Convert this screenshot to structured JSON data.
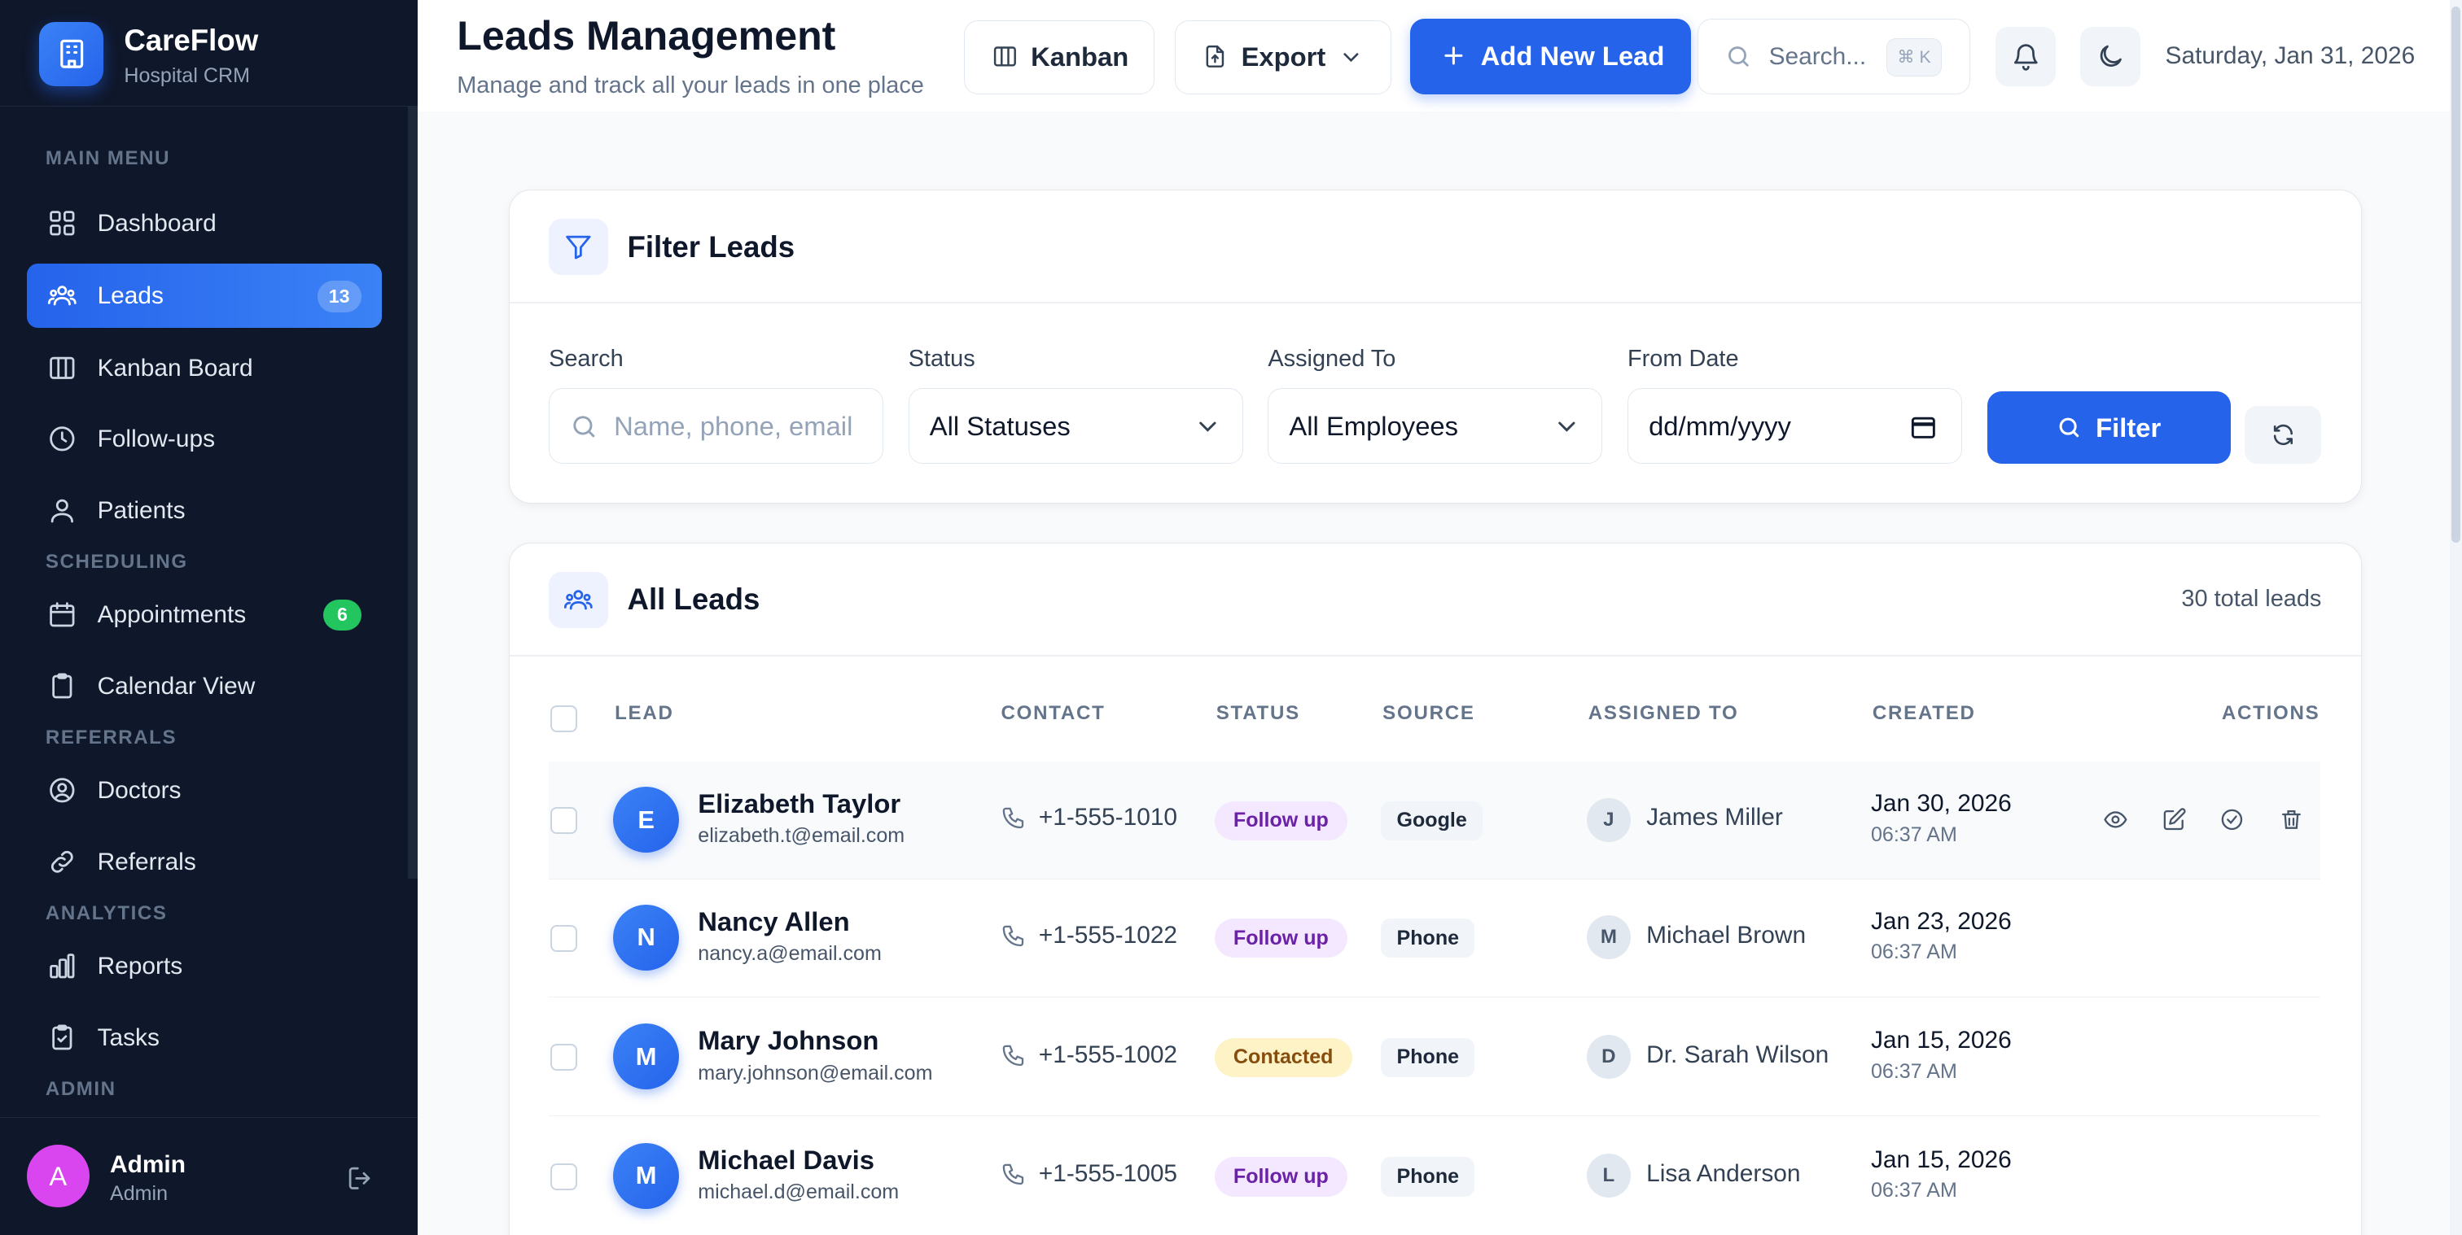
{
  "brand": {
    "name": "CareFlow",
    "subtitle": "Hospital CRM"
  },
  "sidebar": {
    "sections": [
      {
        "id": "main",
        "label": "MAIN MENU"
      },
      {
        "id": "scheduling",
        "label": "SCHEDULING"
      },
      {
        "id": "referrals",
        "label": "REFERRALS"
      },
      {
        "id": "analytics",
        "label": "ANALYTICS"
      },
      {
        "id": "admin",
        "label": "ADMIN"
      }
    ],
    "items": [
      {
        "label": "Dashboard",
        "icon": "dashboard-icon"
      },
      {
        "label": "Leads",
        "icon": "users-icon",
        "badge": "13",
        "active": true
      },
      {
        "label": "Kanban Board",
        "icon": "kanban-icon"
      },
      {
        "label": "Follow-ups",
        "icon": "clock-icon"
      },
      {
        "label": "Patients",
        "icon": "user-icon"
      },
      {
        "label": "Appointments",
        "icon": "calendar-icon",
        "badge": "6"
      },
      {
        "label": "Calendar View",
        "icon": "clipboard-icon"
      },
      {
        "label": "Doctors",
        "icon": "user-circle-icon"
      },
      {
        "label": "Referrals",
        "icon": "link-icon"
      },
      {
        "label": "Reports",
        "icon": "bar-chart-icon"
      },
      {
        "label": "Tasks",
        "icon": "clipboard-check-icon"
      }
    ],
    "user": {
      "initial": "A",
      "name": "Admin",
      "role": "Admin"
    }
  },
  "header": {
    "title": "Leads Management",
    "subtitle": "Manage and track all your leads in one place",
    "kanban_label": "Kanban",
    "export_label": "Export",
    "add_label": "Add New Lead",
    "search_placeholder": "Search...",
    "shortcut": "⌘ K",
    "date": "Saturday, Jan 31, 2026"
  },
  "filters": {
    "title": "Filter Leads",
    "search_label": "Search",
    "search_placeholder": "Name, phone, email",
    "status_label": "Status",
    "status_value": "All Statuses",
    "assigned_label": "Assigned To",
    "assigned_value": "All Employees",
    "from_date_label": "From Date",
    "from_date_placeholder": "dd/mm/yyyy",
    "filter_button": "Filter"
  },
  "leads": {
    "title": "All Leads",
    "total": "30 total leads",
    "columns": [
      "LEAD",
      "CONTACT",
      "STATUS",
      "SOURCE",
      "ASSIGNED TO",
      "CREATED",
      "ACTIONS"
    ],
    "rows": [
      {
        "initial": "E",
        "name": "Elizabeth Taylor",
        "email": "elizabeth.t@email.com",
        "phone": "+1-555-1010",
        "status": "Follow up",
        "status_kind": "follow",
        "source": "Google",
        "assignee_initial": "J",
        "assignee": "James Miller",
        "date": "Jan 30, 2026",
        "time": "06:37 AM"
      },
      {
        "initial": "N",
        "name": "Nancy Allen",
        "email": "nancy.a@email.com",
        "phone": "+1-555-1022",
        "status": "Follow up",
        "status_kind": "follow",
        "source": "Phone",
        "assignee_initial": "M",
        "assignee": "Michael Brown",
        "date": "Jan 23, 2026",
        "time": "06:37 AM"
      },
      {
        "initial": "M",
        "name": "Mary Johnson",
        "email": "mary.johnson@email.com",
        "phone": "+1-555-1002",
        "status": "Contacted",
        "status_kind": "contacted",
        "source": "Phone",
        "assignee_initial": "D",
        "assignee": "Dr. Sarah Wilson",
        "date": "Jan 15, 2026",
        "time": "06:37 AM"
      },
      {
        "initial": "M",
        "name": "Michael Davis",
        "email": "michael.d@email.com",
        "phone": "+1-555-1005",
        "status": "Follow up",
        "status_kind": "follow",
        "source": "Phone",
        "assignee_initial": "L",
        "assignee": "Lisa Anderson",
        "date": "Jan 15, 2026",
        "time": "06:37 AM"
      }
    ]
  },
  "colors": {
    "accent": "#2563eb",
    "sidebar_bg": "#0f172a",
    "follow_bg": "#f3e8ff",
    "contacted_bg": "#fef3c7"
  }
}
